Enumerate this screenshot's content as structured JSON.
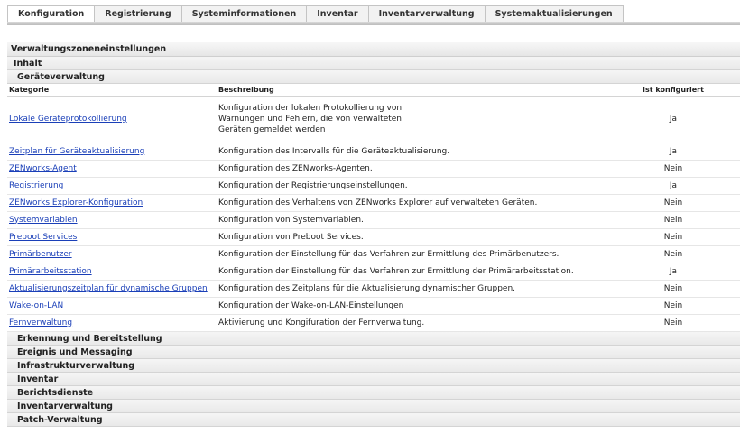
{
  "tabs": [
    {
      "label": "Konfiguration",
      "active": true
    },
    {
      "label": "Registrierung",
      "active": false
    },
    {
      "label": "Systeminformationen",
      "active": false
    },
    {
      "label": "Inventar",
      "active": false
    },
    {
      "label": "Inventarverwaltung",
      "active": false
    },
    {
      "label": "Systemaktualisierungen",
      "active": false
    }
  ],
  "section_title": "Verwaltungszoneneinstellungen",
  "groups_top": [
    "Inhalt",
    "Geräteverwaltung"
  ],
  "table": {
    "headers": {
      "category": "Kategorie",
      "description": "Beschreibung",
      "configured": "Ist konfiguriert"
    },
    "rows": [
      {
        "category": "Lokale Geräteprotokollierung",
        "description": [
          "Konfiguration der lokalen Protokollierung von",
          "Warnungen und Fehlern, die von verwalteten",
          "Geräten gemeldet werden"
        ],
        "configured": "Ja"
      },
      {
        "category": "Zeitplan für Geräteaktualisierung",
        "description": [
          "Konfiguration des Intervalls für die Geräteaktualisierung."
        ],
        "configured": "Ja"
      },
      {
        "category": "ZENworks-Agent",
        "description": [
          "Konfiguration des ZENworks-Agenten."
        ],
        "configured": "Nein"
      },
      {
        "category": "Registrierung",
        "description": [
          "Konfiguration der Registrierungseinstellungen."
        ],
        "configured": "Ja"
      },
      {
        "category": "ZENworks Explorer-Konfiguration",
        "description": [
          "Konfiguration des Verhaltens von ZENworks Explorer auf verwalteten Geräten."
        ],
        "configured": "Nein"
      },
      {
        "category": "Systemvariablen",
        "description": [
          "Konfiguration von Systemvariablen."
        ],
        "configured": "Nein"
      },
      {
        "category": "Preboot Services",
        "description": [
          "Konfiguration von Preboot Services."
        ],
        "configured": "Nein"
      },
      {
        "category": "Primärbenutzer",
        "description": [
          "Konfiguration der Einstellung für das Verfahren zur Ermittlung des Primärbenutzers."
        ],
        "configured": "Nein"
      },
      {
        "category": "Primärarbeitsstation",
        "description": [
          "Konfiguration der Einstellung für das Verfahren zur Ermittlung der Primärarbeitsstation."
        ],
        "configured": "Ja"
      },
      {
        "category": "Aktualisierungszeitplan für dynamische Gruppen",
        "description": [
          "Konfiguration des Zeitplans für die Aktualisierung dynamischer Gruppen."
        ],
        "configured": "Nein"
      },
      {
        "category": "Wake-on-LAN",
        "description": [
          "Konfiguration der Wake-on-LAN-Einstellungen"
        ],
        "configured": "Nein"
      },
      {
        "category": "Fernverwaltung",
        "description": [
          "Aktivierung und Kongifuration der Fernverwaltung."
        ],
        "configured": "Nein"
      }
    ]
  },
  "groups_bottom": [
    "Erkennung und Bereitstellung",
    "Ereignis und Messaging",
    "Infrastrukturverwaltung",
    "Inventar",
    "Berichtsdienste",
    "Inventarverwaltung",
    "Patch-Verwaltung"
  ]
}
